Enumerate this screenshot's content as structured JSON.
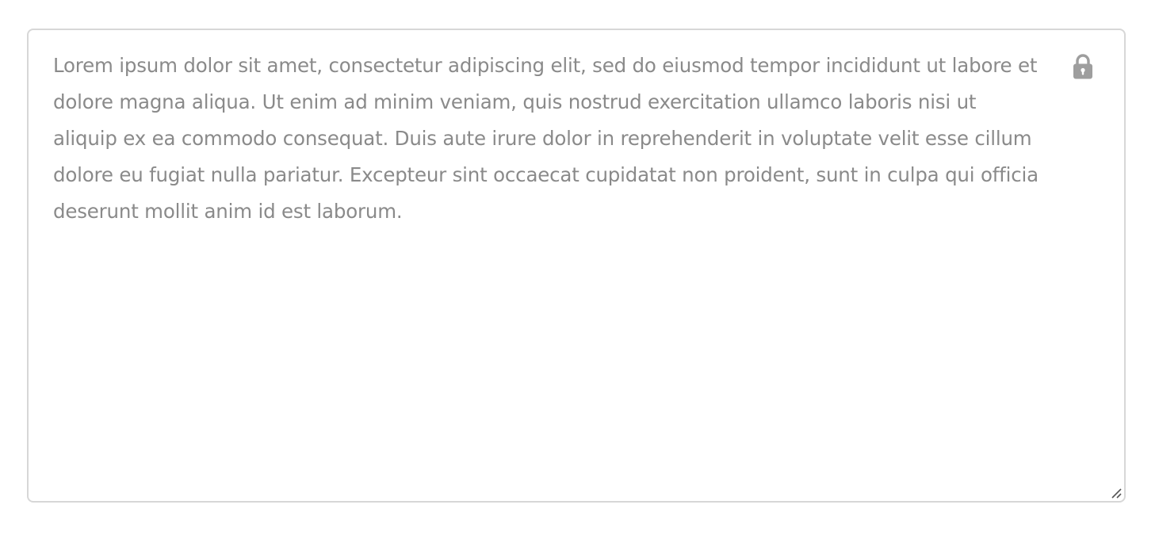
{
  "textarea": {
    "value": "Lorem ipsum dolor sit amet, consectetur adipiscing elit, sed do eiusmod tempor incididunt ut labore et dolore magna aliqua. Ut enim ad minim veniam, quis nostrud exercitation ullamco laboris nisi ut aliquip ex ea commodo consequat. Duis aute irure dolor in reprehenderit in voluptate velit esse cillum dolore eu fugiat nulla pariatur. Excepteur sint occaecat cupidatat non proident, sunt in culpa qui officia deserunt mollit anim id est laborum.",
    "state": "read-only",
    "lock_icon": "lock-icon",
    "resize_icon": "resize-handle-icon"
  },
  "colors": {
    "text": "#8a8a8a",
    "border": "#d7d7d7",
    "icon": "#9e9e9e",
    "background": "#ffffff"
  }
}
